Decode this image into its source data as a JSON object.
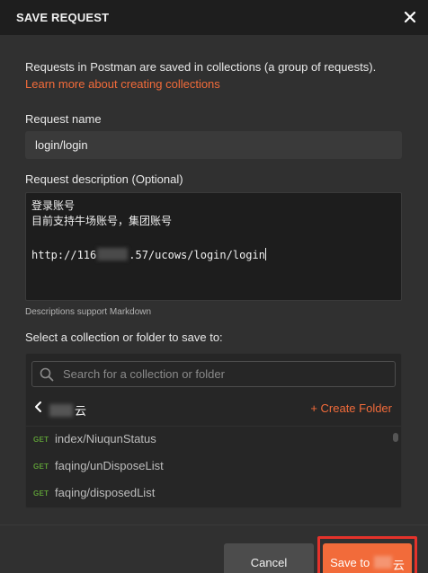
{
  "dialog": {
    "title": "SAVE REQUEST",
    "intro": "Requests in Postman are saved in collections (a group of requests).",
    "learn_link": "Learn more about creating collections"
  },
  "request_name": {
    "label": "Request name",
    "value": "login/login"
  },
  "request_description": {
    "label": "Request description (Optional)",
    "lines": [
      "登录账号",
      "目前支持牛场账号，集团账号",
      "",
      "http://116",
      ".57/ucows/login/login"
    ],
    "hint": "Descriptions support Markdown"
  },
  "collection": {
    "label": "Select a collection or folder to save to:",
    "search_placeholder": "Search for a collection or folder",
    "current_name_suffix": "云",
    "create_folder": "+ Create Folder",
    "requests": [
      {
        "method": "GET",
        "name": "index/NiuqunStatus"
      },
      {
        "method": "GET",
        "name": "faqing/unDisposeList"
      },
      {
        "method": "GET",
        "name": "faqing/disposedList"
      }
    ]
  },
  "footer": {
    "cancel": "Cancel",
    "save_prefix": "Save to",
    "save_suffix": "云"
  },
  "colors": {
    "accent": "#f26b3a",
    "get_method": "#5c9a36",
    "highlight": "#e5322b"
  }
}
